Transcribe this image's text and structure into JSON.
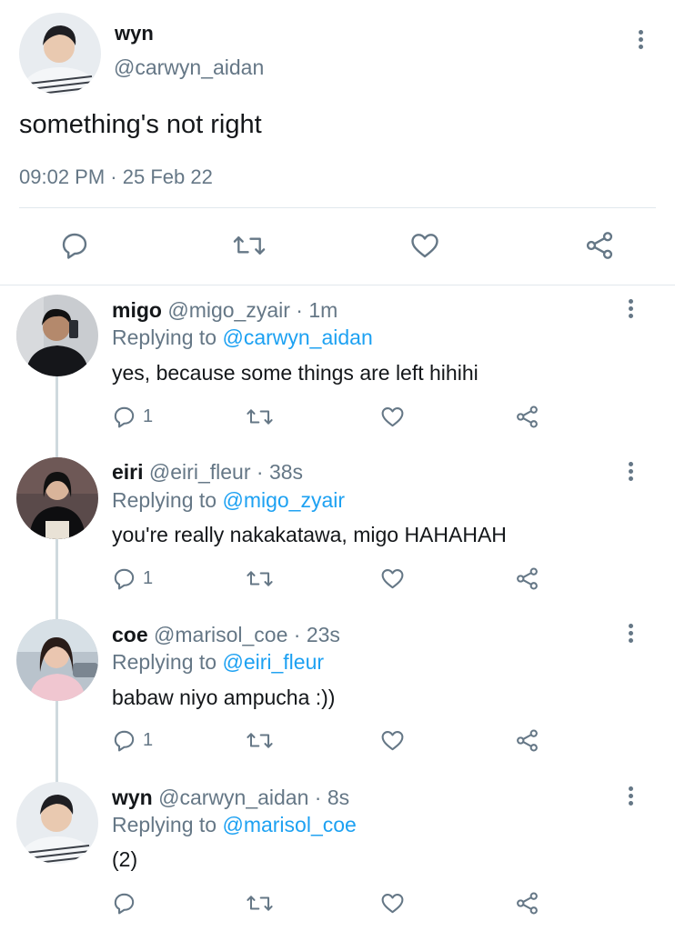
{
  "main_tweet": {
    "name": "wyn",
    "handle": "@carwyn_aidan",
    "text": "something's not right",
    "time": "09:02 PM",
    "separator": "·",
    "date": "25 Feb 22"
  },
  "replies": [
    {
      "name": "migo",
      "handle": "@migo_zyair",
      "age": "1m",
      "replying_prefix": "Replying to",
      "replying_to": "@carwyn_aidan",
      "text": "yes, because some things are left hihihi",
      "reply_count": "1"
    },
    {
      "name": "eiri",
      "handle": "@eiri_fleur",
      "age": "38s",
      "replying_prefix": "Replying to",
      "replying_to": "@migo_zyair",
      "text": "you're really nakakatawa, migo HAHAHAH",
      "reply_count": "1"
    },
    {
      "name": "coe",
      "handle": "@marisol_coe",
      "age": "23s",
      "replying_prefix": "Replying to",
      "replying_to": "@eiri_fleur",
      "text": "babaw niyo ampucha :))",
      "reply_count": "1"
    },
    {
      "name": "wyn",
      "handle": "@carwyn_aidan",
      "age": "8s",
      "replying_prefix": "Replying to",
      "replying_to": "@marisol_coe",
      "text": "(2)",
      "reply_count": ""
    }
  ],
  "icons": {
    "reply": "reply-icon",
    "retweet": "retweet-icon",
    "like": "like-icon",
    "share": "share-icon",
    "more": "more-options-icon"
  },
  "colors": {
    "text": "#14171a",
    "muted": "#657786",
    "link": "#1da1f2",
    "divider": "#e1e8ed"
  }
}
